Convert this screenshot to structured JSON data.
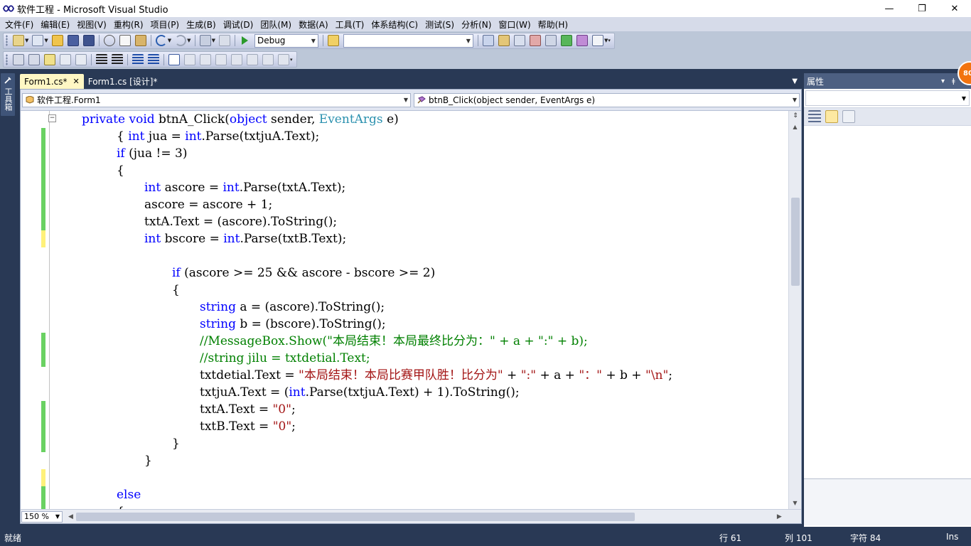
{
  "window": {
    "title": "软件工程 - Microsoft Visual Studio",
    "controls": [
      "—",
      "❐",
      "✕"
    ]
  },
  "menu": [
    "文件(F)",
    "编辑(E)",
    "视图(V)",
    "重构(R)",
    "项目(P)",
    "生成(B)",
    "调试(D)",
    "团队(M)",
    "数据(A)",
    "工具(T)",
    "体系结构(C)",
    "测试(S)",
    "分析(N)",
    "窗口(W)",
    "帮助(H)"
  ],
  "toolbar": {
    "config_value": "Debug",
    "platform_value": ""
  },
  "toolbox_tab": {
    "label": "工具箱"
  },
  "doc_tabs": [
    {
      "label": "Form1.cs*",
      "close": "✕"
    },
    {
      "label": "Form1.cs [设计]*"
    }
  ],
  "nav": {
    "class_value": "软件工程.Form1",
    "member_value": "btnB_Click(object sender, EventArgs e)"
  },
  "code_lines": [
    "private void btnA_Click(object sender, EventArgs e)",
    "{ int jua = int.Parse(txtjuA.Text);",
    "if (jua != 3)",
    "{",
    "int ascore = int.Parse(txtA.Text);",
    "ascore = ascore + 1;",
    "txtA.Text = (ascore).ToString();",
    "int bscore = int.Parse(txtB.Text);",
    "",
    "if (ascore >= 25 && ascore - bscore >= 2)",
    "{",
    "string a = (ascore).ToString();",
    "string b = (bscore).ToString();",
    "//MessageBox.Show(\"本局结束！本局最终比分为：\" + a + \":\" + b);",
    "//string jilu = txtdetial.Text;",
    "txtdetial.Text = \"本局结束！本局比赛甲队胜！比分为\" + \":\" + a + \"：\" + b + \"\\n\";",
    "txtjuA.Text = (int.Parse(txtjuA.Text) + 1).ToString();",
    "txtA.Text = \"0\";",
    "txtB.Text = \"0\";",
    "}",
    "}",
    "",
    "else",
    "{"
  ],
  "change_marks": [
    {
      "from_line": 1,
      "to_line": 7,
      "color": "#6ad162"
    },
    {
      "from_line": 7,
      "to_line": 8,
      "color": "#fff17a"
    },
    {
      "from_line": 13,
      "to_line": 15,
      "color": "#6ad162"
    },
    {
      "from_line": 17,
      "to_line": 20,
      "color": "#6ad162"
    },
    {
      "from_line": 21,
      "to_line": 22,
      "color": "#fff17a"
    },
    {
      "from_line": 22,
      "to_line": 24,
      "color": "#6ad162"
    }
  ],
  "zoom": "150 %",
  "properties": {
    "title": "属性",
    "pin": "ǂ",
    "close": "✕",
    "dropdown": "▾"
  },
  "badge": "80",
  "status": {
    "left": "就绪",
    "line": "行 61",
    "col": "列 101",
    "char": "字符 84",
    "mode": "Ins"
  },
  "colors": {
    "keyword": "#0000ff",
    "type": "#2b91af",
    "string": "#a31515",
    "comment": "#008000",
    "chrome": "#293955"
  }
}
